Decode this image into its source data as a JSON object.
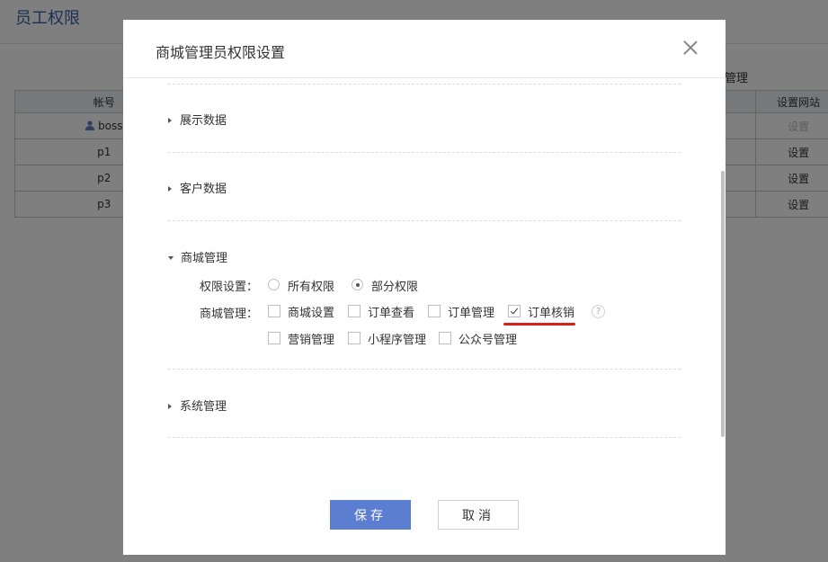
{
  "background": {
    "page_title": "员工权限",
    "column_hint": "管理",
    "table": {
      "headers": [
        "帐号",
        "",
        "设置网站"
      ],
      "rows": [
        {
          "account": "boss",
          "action": "设置",
          "has_icon": true,
          "disabled": true
        },
        {
          "account": "p1",
          "action": "设置",
          "has_icon": false,
          "disabled": false
        },
        {
          "account": "p2",
          "action": "设置",
          "has_icon": false,
          "disabled": false
        },
        {
          "account": "p3",
          "action": "设置",
          "has_icon": false,
          "disabled": false
        }
      ]
    }
  },
  "modal": {
    "title": "商城管理员权限设置",
    "sections": {
      "display": {
        "label": "展示数据",
        "expanded": false
      },
      "customer": {
        "label": "客户数据",
        "expanded": false
      },
      "mall": {
        "label": "商城管理",
        "expanded": true
      },
      "system": {
        "label": "系统管理",
        "expanded": false
      }
    },
    "permission_setting": {
      "label": "权限设置：",
      "options": [
        {
          "label": "所有权限",
          "selected": false
        },
        {
          "label": "部分权限",
          "selected": true
        }
      ]
    },
    "mall_management": {
      "label": "商城管理：",
      "options": [
        {
          "label": "商城设置",
          "checked": false
        },
        {
          "label": "订单查看",
          "checked": false
        },
        {
          "label": "订单管理",
          "checked": false
        },
        {
          "label": "订单核销",
          "checked": true
        },
        {
          "label": "营销管理",
          "checked": false
        },
        {
          "label": "小程序管理",
          "checked": false
        },
        {
          "label": "公众号管理",
          "checked": false
        }
      ],
      "help_icon": "?"
    },
    "buttons": {
      "save": "保存",
      "cancel": "取消"
    }
  },
  "colors": {
    "primary_button": "#5b7ed0",
    "highlight_underline": "#d7201f",
    "page_title": "#3a5fa8"
  },
  "icons": [
    "user-icon",
    "close-icon",
    "caret-right-icon",
    "caret-down-icon",
    "check-icon",
    "help-icon"
  ]
}
